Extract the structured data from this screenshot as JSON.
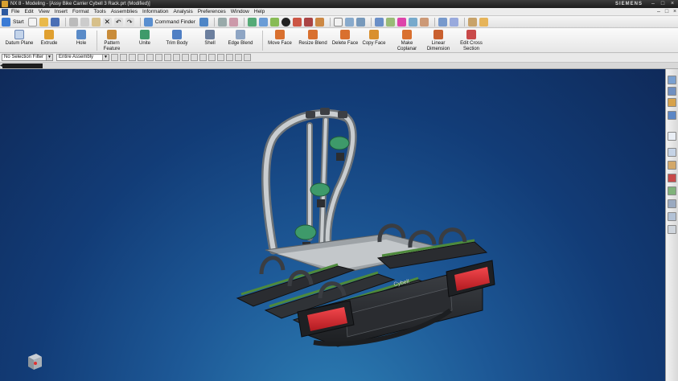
{
  "window": {
    "title": "NX 8 - Modeling - [Assy Bike Carrier Cybell 3 Rack.prt (Modified)]",
    "brand": "SIEMENS"
  },
  "menu": [
    "File",
    "Edit",
    "View",
    "Insert",
    "Format",
    "Tools",
    "Assemblies",
    "Information",
    "Analysis",
    "Preferences",
    "Window",
    "Help"
  ],
  "standard_toolbar": {
    "start_label": "Start",
    "command_finder_label": "Command Finder"
  },
  "ribbon": [
    "Datum Plane",
    "Extrude",
    "Hole",
    "Pattern Feature",
    "Unite",
    "Trim Body",
    "Shell",
    "Edge Blend",
    "Move Face",
    "Resize Blend",
    "Delete Face",
    "Copy Face",
    "Make Coplanar",
    "Linear Dimension",
    "Edit Cross Section"
  ],
  "selection_bar": {
    "filter_value": "No Selection Filter",
    "scope_value": "Entire Assembly"
  },
  "model": {
    "logo_text": "Cybell"
  },
  "colors": {
    "viewport_top": "#0f2a5a",
    "viewport_bottom": "#2d80b5",
    "frame_gray": "#a9adb0",
    "clamp_green": "#3e9a6a",
    "tail_light_red": "#d8232a",
    "body_dark": "#2a2c30"
  }
}
